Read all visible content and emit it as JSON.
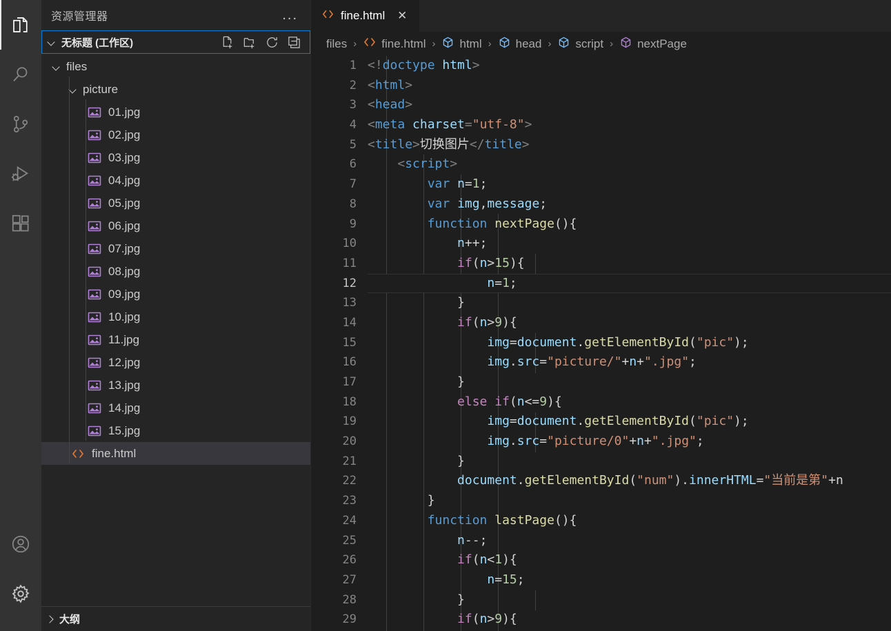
{
  "activity_bar": {
    "items": [
      {
        "name": "explorer",
        "icon": "files-icon",
        "active": true
      },
      {
        "name": "search",
        "icon": "search-icon",
        "active": false
      },
      {
        "name": "source-control",
        "icon": "source-control-icon",
        "active": false
      },
      {
        "name": "run-debug",
        "icon": "run-and-debug-icon",
        "active": false
      },
      {
        "name": "extensions",
        "icon": "extensions-icon",
        "active": false
      }
    ],
    "bottom_items": [
      {
        "name": "accounts",
        "icon": "account-icon"
      },
      {
        "name": "manage",
        "icon": "gear-icon"
      }
    ]
  },
  "sidebar": {
    "title": "资源管理器",
    "more_actions": "...",
    "workspace": {
      "label": "无标题 (工作区)",
      "actions": [
        "new-file-icon",
        "new-folder-icon",
        "refresh-icon",
        "collapse-all-icon"
      ]
    },
    "tree": [
      {
        "label": "files",
        "type": "folder",
        "depth": 0,
        "expanded": true
      },
      {
        "label": "picture",
        "type": "folder",
        "depth": 1,
        "expanded": true
      },
      {
        "label": "01.jpg",
        "type": "image",
        "depth": 2
      },
      {
        "label": "02.jpg",
        "type": "image",
        "depth": 2
      },
      {
        "label": "03.jpg",
        "type": "image",
        "depth": 2
      },
      {
        "label": "04.jpg",
        "type": "image",
        "depth": 2
      },
      {
        "label": "05.jpg",
        "type": "image",
        "depth": 2
      },
      {
        "label": "06.jpg",
        "type": "image",
        "depth": 2
      },
      {
        "label": "07.jpg",
        "type": "image",
        "depth": 2
      },
      {
        "label": "08.jpg",
        "type": "image",
        "depth": 2
      },
      {
        "label": "09.jpg",
        "type": "image",
        "depth": 2
      },
      {
        "label": "10.jpg",
        "type": "image",
        "depth": 2
      },
      {
        "label": "11.jpg",
        "type": "image",
        "depth": 2
      },
      {
        "label": "12.jpg",
        "type": "image",
        "depth": 2
      },
      {
        "label": "13.jpg",
        "type": "image",
        "depth": 2
      },
      {
        "label": "14.jpg",
        "type": "image",
        "depth": 2
      },
      {
        "label": "15.jpg",
        "type": "image",
        "depth": 2
      },
      {
        "label": "fine.html",
        "type": "html",
        "depth": 1,
        "selected": true
      }
    ],
    "outline": {
      "label": "大纲",
      "expanded": false
    }
  },
  "editor": {
    "tabs": [
      {
        "label": "fine.html",
        "icon": "html-file-icon",
        "active": true,
        "close": "✕"
      }
    ],
    "breadcrumbs": [
      {
        "label": "files",
        "icon": "none"
      },
      {
        "label": "fine.html",
        "icon": "html-file-icon"
      },
      {
        "label": "html",
        "icon": "symbol-field-blue"
      },
      {
        "label": "head",
        "icon": "symbol-field-blue"
      },
      {
        "label": "script",
        "icon": "symbol-field-blue"
      },
      {
        "label": "nextPage",
        "icon": "symbol-method-purple"
      }
    ],
    "breadcrumb_separator": "›",
    "active_line": 12,
    "first_line": 1,
    "lines": [
      {
        "n": 1,
        "tokens": [
          {
            "t": "punct",
            "v": "<!"
          },
          {
            "t": "tag",
            "v": "doctype"
          },
          {
            "t": "attr",
            "v": " html"
          },
          {
            "t": "punct",
            "v": ">"
          }
        ]
      },
      {
        "n": 2,
        "tokens": [
          {
            "t": "punct",
            "v": "<"
          },
          {
            "t": "tag",
            "v": "html"
          },
          {
            "t": "punct",
            "v": ">"
          }
        ]
      },
      {
        "n": 3,
        "tokens": [
          {
            "t": "punct",
            "v": "<"
          },
          {
            "t": "tag",
            "v": "head"
          },
          {
            "t": "punct",
            "v": ">"
          }
        ]
      },
      {
        "n": 4,
        "tokens": [
          {
            "t": "punct",
            "v": "<"
          },
          {
            "t": "tag",
            "v": "meta"
          },
          {
            "t": "attr",
            "v": " charset"
          },
          {
            "t": "punct",
            "v": "="
          },
          {
            "t": "str",
            "v": "\"utf-8\""
          },
          {
            "t": "punct",
            "v": ">"
          }
        ]
      },
      {
        "n": 5,
        "tokens": [
          {
            "t": "punct",
            "v": "<"
          },
          {
            "t": "tag",
            "v": "title"
          },
          {
            "t": "punct",
            "v": ">"
          },
          {
            "t": "text",
            "v": "切换图片"
          },
          {
            "t": "punct",
            "v": "</"
          },
          {
            "t": "tag",
            "v": "title"
          },
          {
            "t": "punct",
            "v": ">"
          }
        ]
      },
      {
        "n": 6,
        "tokens": [
          {
            "t": "plain",
            "v": "    "
          },
          {
            "t": "punct",
            "v": "<"
          },
          {
            "t": "tag",
            "v": "script"
          },
          {
            "t": "punct",
            "v": ">"
          }
        ]
      },
      {
        "n": 7,
        "tokens": [
          {
            "t": "plain",
            "v": "        "
          },
          {
            "t": "kw",
            "v": "var"
          },
          {
            "t": "plain",
            "v": " "
          },
          {
            "t": "var",
            "v": "n"
          },
          {
            "t": "plain",
            "v": "="
          },
          {
            "t": "num",
            "v": "1"
          },
          {
            "t": "plain",
            "v": ";"
          }
        ]
      },
      {
        "n": 8,
        "tokens": [
          {
            "t": "plain",
            "v": "        "
          },
          {
            "t": "kw",
            "v": "var"
          },
          {
            "t": "plain",
            "v": " "
          },
          {
            "t": "var",
            "v": "img"
          },
          {
            "t": "plain",
            "v": ","
          },
          {
            "t": "var",
            "v": "message"
          },
          {
            "t": "plain",
            "v": ";"
          }
        ]
      },
      {
        "n": 9,
        "tokens": [
          {
            "t": "plain",
            "v": "        "
          },
          {
            "t": "kw",
            "v": "function"
          },
          {
            "t": "plain",
            "v": " "
          },
          {
            "t": "fn",
            "v": "nextPage"
          },
          {
            "t": "plain",
            "v": "(){"
          }
        ]
      },
      {
        "n": 10,
        "tokens": [
          {
            "t": "plain",
            "v": "            "
          },
          {
            "t": "var",
            "v": "n"
          },
          {
            "t": "plain",
            "v": "++;"
          }
        ]
      },
      {
        "n": 11,
        "tokens": [
          {
            "t": "plain",
            "v": "            "
          },
          {
            "t": "ctrl",
            "v": "if"
          },
          {
            "t": "plain",
            "v": "("
          },
          {
            "t": "var",
            "v": "n"
          },
          {
            "t": "plain",
            "v": ">"
          },
          {
            "t": "num",
            "v": "15"
          },
          {
            "t": "plain",
            "v": "){"
          }
        ]
      },
      {
        "n": 12,
        "tokens": [
          {
            "t": "plain",
            "v": "                "
          },
          {
            "t": "var",
            "v": "n"
          },
          {
            "t": "plain",
            "v": "="
          },
          {
            "t": "num",
            "v": "1"
          },
          {
            "t": "plain",
            "v": ";"
          }
        ]
      },
      {
        "n": 13,
        "tokens": [
          {
            "t": "plain",
            "v": "            }"
          }
        ]
      },
      {
        "n": 14,
        "tokens": [
          {
            "t": "plain",
            "v": "            "
          },
          {
            "t": "ctrl",
            "v": "if"
          },
          {
            "t": "plain",
            "v": "("
          },
          {
            "t": "var",
            "v": "n"
          },
          {
            "t": "plain",
            "v": ">"
          },
          {
            "t": "num",
            "v": "9"
          },
          {
            "t": "plain",
            "v": "){"
          }
        ]
      },
      {
        "n": 15,
        "tokens": [
          {
            "t": "plain",
            "v": "                "
          },
          {
            "t": "var",
            "v": "img"
          },
          {
            "t": "plain",
            "v": "="
          },
          {
            "t": "var",
            "v": "document"
          },
          {
            "t": "plain",
            "v": "."
          },
          {
            "t": "fn",
            "v": "getElementById"
          },
          {
            "t": "plain",
            "v": "("
          },
          {
            "t": "str",
            "v": "\"pic\""
          },
          {
            "t": "plain",
            "v": ");"
          }
        ]
      },
      {
        "n": 16,
        "tokens": [
          {
            "t": "plain",
            "v": "                "
          },
          {
            "t": "var",
            "v": "img"
          },
          {
            "t": "plain",
            "v": "."
          },
          {
            "t": "var",
            "v": "src"
          },
          {
            "t": "plain",
            "v": "="
          },
          {
            "t": "str",
            "v": "\"picture/\""
          },
          {
            "t": "plain",
            "v": "+"
          },
          {
            "t": "var",
            "v": "n"
          },
          {
            "t": "plain",
            "v": "+"
          },
          {
            "t": "str",
            "v": "\".jpg\""
          },
          {
            "t": "plain",
            "v": ";"
          }
        ]
      },
      {
        "n": 17,
        "tokens": [
          {
            "t": "plain",
            "v": "            }"
          }
        ]
      },
      {
        "n": 18,
        "tokens": [
          {
            "t": "plain",
            "v": "            "
          },
          {
            "t": "ctrl",
            "v": "else if"
          },
          {
            "t": "plain",
            "v": "("
          },
          {
            "t": "var",
            "v": "n"
          },
          {
            "t": "plain",
            "v": "<="
          },
          {
            "t": "num",
            "v": "9"
          },
          {
            "t": "plain",
            "v": "){"
          }
        ]
      },
      {
        "n": 19,
        "tokens": [
          {
            "t": "plain",
            "v": "                "
          },
          {
            "t": "var",
            "v": "img"
          },
          {
            "t": "plain",
            "v": "="
          },
          {
            "t": "var",
            "v": "document"
          },
          {
            "t": "plain",
            "v": "."
          },
          {
            "t": "fn",
            "v": "getElementById"
          },
          {
            "t": "plain",
            "v": "("
          },
          {
            "t": "str",
            "v": "\"pic\""
          },
          {
            "t": "plain",
            "v": ");"
          }
        ]
      },
      {
        "n": 20,
        "tokens": [
          {
            "t": "plain",
            "v": "                "
          },
          {
            "t": "var",
            "v": "img"
          },
          {
            "t": "plain",
            "v": "."
          },
          {
            "t": "var",
            "v": "src"
          },
          {
            "t": "plain",
            "v": "="
          },
          {
            "t": "str",
            "v": "\"picture/0\""
          },
          {
            "t": "plain",
            "v": "+"
          },
          {
            "t": "var",
            "v": "n"
          },
          {
            "t": "plain",
            "v": "+"
          },
          {
            "t": "str",
            "v": "\".jpg\""
          },
          {
            "t": "plain",
            "v": ";"
          }
        ]
      },
      {
        "n": 21,
        "tokens": [
          {
            "t": "plain",
            "v": "            }"
          }
        ]
      },
      {
        "n": 22,
        "tokens": [
          {
            "t": "plain",
            "v": "            "
          },
          {
            "t": "var",
            "v": "document"
          },
          {
            "t": "plain",
            "v": "."
          },
          {
            "t": "fn",
            "v": "getElementById"
          },
          {
            "t": "plain",
            "v": "("
          },
          {
            "t": "str",
            "v": "\"num\""
          },
          {
            "t": "plain",
            "v": ")."
          },
          {
            "t": "var",
            "v": "innerHTML"
          },
          {
            "t": "plain",
            "v": "="
          },
          {
            "t": "str",
            "v": "\"当前是第\""
          },
          {
            "t": "plain",
            "v": "+n"
          }
        ]
      },
      {
        "n": 23,
        "tokens": [
          {
            "t": "plain",
            "v": "        }"
          }
        ]
      },
      {
        "n": 24,
        "tokens": [
          {
            "t": "plain",
            "v": "        "
          },
          {
            "t": "kw",
            "v": "function"
          },
          {
            "t": "plain",
            "v": " "
          },
          {
            "t": "fn",
            "v": "lastPage"
          },
          {
            "t": "plain",
            "v": "(){"
          }
        ]
      },
      {
        "n": 25,
        "tokens": [
          {
            "t": "plain",
            "v": "            "
          },
          {
            "t": "var",
            "v": "n"
          },
          {
            "t": "plain",
            "v": "--;"
          }
        ]
      },
      {
        "n": 26,
        "tokens": [
          {
            "t": "plain",
            "v": "            "
          },
          {
            "t": "ctrl",
            "v": "if"
          },
          {
            "t": "plain",
            "v": "("
          },
          {
            "t": "var",
            "v": "n"
          },
          {
            "t": "plain",
            "v": "<"
          },
          {
            "t": "num",
            "v": "1"
          },
          {
            "t": "plain",
            "v": "){"
          }
        ]
      },
      {
        "n": 27,
        "tokens": [
          {
            "t": "plain",
            "v": "                "
          },
          {
            "t": "var",
            "v": "n"
          },
          {
            "t": "plain",
            "v": "="
          },
          {
            "t": "num",
            "v": "15"
          },
          {
            "t": "plain",
            "v": ";"
          }
        ]
      },
      {
        "n": 28,
        "tokens": [
          {
            "t": "plain",
            "v": "            }"
          }
        ]
      },
      {
        "n": 29,
        "tokens": [
          {
            "t": "plain",
            "v": "            "
          },
          {
            "t": "ctrl",
            "v": "if"
          },
          {
            "t": "plain",
            "v": "("
          },
          {
            "t": "var",
            "v": "n"
          },
          {
            "t": "plain",
            "v": ">"
          },
          {
            "t": "num",
            "v": "9"
          },
          {
            "t": "plain",
            "v": "){"
          }
        ]
      }
    ]
  },
  "colors": {
    "activity_bar_bg": "#333333",
    "sidebar_bg": "#252526",
    "editor_bg": "#1e1e1e",
    "focus_border": "#007fd4",
    "selection_bg": "#37373d",
    "image_icon": "#b180d7",
    "html_icon": "#e37933",
    "symbol_field": "#75beff",
    "symbol_method": "#b180d7"
  }
}
